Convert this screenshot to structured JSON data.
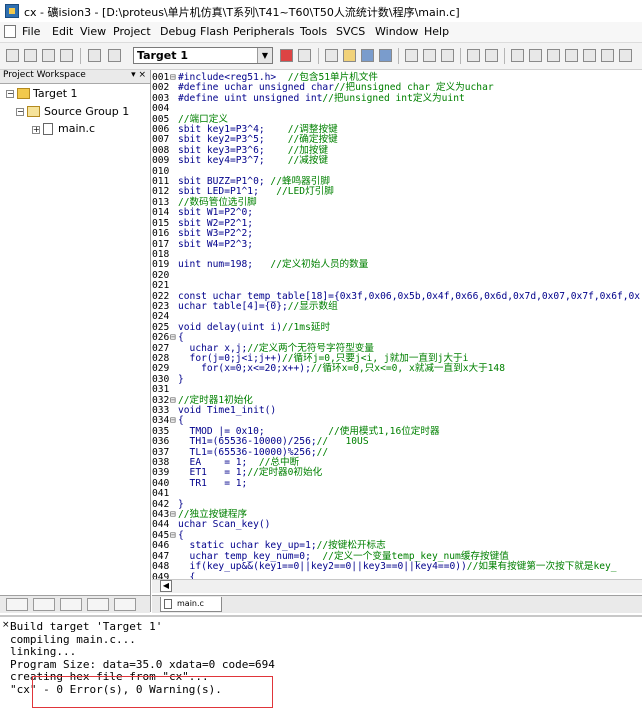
{
  "window": {
    "title": "cx - 礦ision3 - [D:\\proteus\\单片机仿真\\T系列\\T41~T60\\T50人流统计数\\程序\\main.c]"
  },
  "menu": {
    "items": [
      "File",
      "Edit",
      "View",
      "Project",
      "Debug",
      "Flash",
      "Peripherals",
      "Tools",
      "SVCS",
      "Window",
      "Help"
    ]
  },
  "toolbar": {
    "target": "Target 1"
  },
  "project": {
    "header": "Project Workspace",
    "close": "▾ ×",
    "target": "Target 1",
    "group": "Source Group 1",
    "file": "main.c"
  },
  "editor": {
    "tab_label": "main.c",
    "lines": [
      {
        "n": "001",
        "f": "⊟",
        "code": "#include<reg51.h>  ",
        "comment": "//包含51单片机文件"
      },
      {
        "n": "002",
        "f": " ",
        "code": "#define uchar unsigned char",
        "comment": "//把unsigned char 定义为uchar"
      },
      {
        "n": "003",
        "f": " ",
        "code": "#define uint unsigned int",
        "comment": "//把unsigned int定义为uint"
      },
      {
        "n": "004",
        "f": " ",
        "code": "",
        "comment": ""
      },
      {
        "n": "005",
        "f": " ",
        "code": "",
        "comment": "//端口定义"
      },
      {
        "n": "006",
        "f": " ",
        "code": "sbit key1=P3^4;    ",
        "comment": "//调整按键"
      },
      {
        "n": "007",
        "f": " ",
        "code": "sbit key2=P3^5;    ",
        "comment": "//确定按键"
      },
      {
        "n": "008",
        "f": " ",
        "code": "sbit key3=P3^6;    ",
        "comment": "//加按键"
      },
      {
        "n": "009",
        "f": " ",
        "code": "sbit key4=P3^7;    ",
        "comment": "//减按键"
      },
      {
        "n": "010",
        "f": " ",
        "code": "",
        "comment": ""
      },
      {
        "n": "011",
        "f": " ",
        "code": "sbit BUZZ=P1^0; ",
        "comment": "//蜂鸣器引脚"
      },
      {
        "n": "012",
        "f": " ",
        "code": "sbit LED=P1^1;   ",
        "comment": "//LED灯引脚"
      },
      {
        "n": "013",
        "f": " ",
        "code": "",
        "comment": "//数码管位选引脚"
      },
      {
        "n": "014",
        "f": " ",
        "code": "sbit W1=P2^0;",
        "comment": ""
      },
      {
        "n": "015",
        "f": " ",
        "code": "sbit W2=P2^1;",
        "comment": ""
      },
      {
        "n": "016",
        "f": " ",
        "code": "sbit W3=P2^2;",
        "comment": ""
      },
      {
        "n": "017",
        "f": " ",
        "code": "sbit W4=P2^3;",
        "comment": ""
      },
      {
        "n": "018",
        "f": " ",
        "code": "",
        "comment": ""
      },
      {
        "n": "019",
        "f": " ",
        "code": "uint num=198;   ",
        "comment": "//定义初始人员的数量"
      },
      {
        "n": "020",
        "f": " ",
        "code": "",
        "comment": ""
      },
      {
        "n": "021",
        "f": " ",
        "code": "",
        "comment": ""
      },
      {
        "n": "022",
        "f": " ",
        "code": "const uchar temp_table[18]={0x3f,0x06,0x5b,0x4f,0x66,0x6d,0x7d,0x07,0x7f,0x6f,0x",
        "comment": ""
      },
      {
        "n": "023",
        "f": " ",
        "code": "uchar table[4]={0};",
        "comment": "//显示数组"
      },
      {
        "n": "024",
        "f": " ",
        "code": "",
        "comment": ""
      },
      {
        "n": "025",
        "f": " ",
        "code": "void delay(uint i)",
        "comment": "//1ms延时"
      },
      {
        "n": "026",
        "f": "⊟",
        "code": "{",
        "comment": ""
      },
      {
        "n": "027",
        "f": " ",
        "code": "  uchar x,j;",
        "comment": "//定义两个无符号字符型变量"
      },
      {
        "n": "028",
        "f": " ",
        "code": "  for(j=0;j<i;j++)",
        "comment": "//循环j=0,只要j<i, j就加一直到j大于i"
      },
      {
        "n": "029",
        "f": " ",
        "code": "    for(x=0;x<=20;x++);",
        "comment": "//循环x=0,只x<=0, x就减一直到x大于148"
      },
      {
        "n": "030",
        "f": " ",
        "code": "}",
        "comment": ""
      },
      {
        "n": "031",
        "f": " ",
        "code": "",
        "comment": ""
      },
      {
        "n": "032",
        "f": "⊟",
        "code": "",
        "comment": "//定时器1初始化"
      },
      {
        "n": "033",
        "f": " ",
        "code": "void Time1_init()",
        "comment": ""
      },
      {
        "n": "034",
        "f": "⊟",
        "code": "{",
        "comment": ""
      },
      {
        "n": "035",
        "f": " ",
        "code": "  TMOD |= 0x10;           ",
        "comment": "//使用模式1,16位定时器"
      },
      {
        "n": "036",
        "f": " ",
        "code": "  TH1=(65536-10000)/256;",
        "comment": "//   10US"
      },
      {
        "n": "037",
        "f": " ",
        "code": "  TL1=(65536-10000)%256;",
        "comment": "//"
      },
      {
        "n": "038",
        "f": " ",
        "code": "  EA    = 1;  ",
        "comment": "//总中断"
      },
      {
        "n": "039",
        "f": " ",
        "code": "  ET1   = 1;",
        "comment": "//定时器0初始化"
      },
      {
        "n": "040",
        "f": " ",
        "code": "  TR1   = 1;",
        "comment": ""
      },
      {
        "n": "041",
        "f": " ",
        "code": "",
        "comment": ""
      },
      {
        "n": "042",
        "f": " ",
        "code": "}",
        "comment": ""
      },
      {
        "n": "043",
        "f": "⊟",
        "code": "",
        "comment": "//独立按键程序"
      },
      {
        "n": "044",
        "f": " ",
        "code": "uchar Scan_key()",
        "comment": ""
      },
      {
        "n": "045",
        "f": "⊟",
        "code": "{",
        "comment": ""
      },
      {
        "n": "046",
        "f": " ",
        "code": "  static uchar key_up=1;",
        "comment": "//按键松开标志"
      },
      {
        "n": "047",
        "f": " ",
        "code": "  uchar temp_key_num=0;  ",
        "comment": "//定义一个变量temp_key_num缓存按键值"
      },
      {
        "n": "048",
        "f": " ",
        "code": "  if(key_up&&(key1==0||key2==0||key3==0||key4==0))",
        "comment": "//如果有按键第一次按下就是key_"
      },
      {
        "n": "049",
        "f": " ",
        "code": "  {",
        "comment": ""
      }
    ]
  },
  "build": {
    "close": "×",
    "lines": [
      "Build target 'Target 1'",
      "compiling main.c...",
      "linking...",
      "Program Size: data=35.0 xdata=0 code=694",
      "creating hex file from \"cx\"...",
      "\"cx\" - 0 Error(s), 0 Warning(s)."
    ]
  }
}
